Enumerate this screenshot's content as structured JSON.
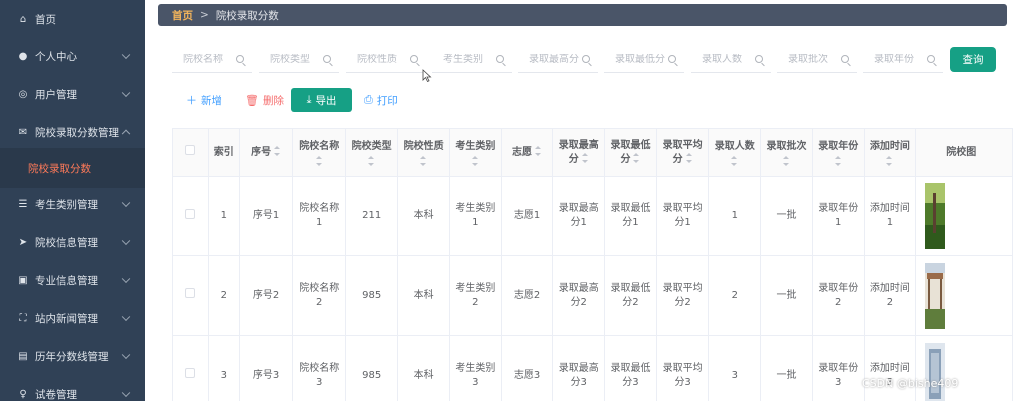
{
  "sidebar": {
    "items": [
      {
        "label": "首页",
        "icon": "home-icon",
        "glyph": "⌂",
        "has_arrow": false
      },
      {
        "label": "个人中心",
        "icon": "user-icon",
        "glyph": "●",
        "has_arrow": true
      },
      {
        "label": "用户管理",
        "icon": "user-manage-icon",
        "glyph": "◎",
        "has_arrow": true
      },
      {
        "label": "院校录取分数管理",
        "icon": "mail-icon",
        "glyph": "✉",
        "has_arrow": true,
        "expanded": true
      },
      {
        "label": "考生类别管理",
        "icon": "sliders-icon",
        "glyph": "☰",
        "has_arrow": true
      },
      {
        "label": "院校信息管理",
        "icon": "send-icon",
        "glyph": "➤",
        "has_arrow": true
      },
      {
        "label": "专业信息管理",
        "icon": "clipboard-icon",
        "glyph": "▣",
        "has_arrow": true
      },
      {
        "label": "站内新闻管理",
        "icon": "frame-icon",
        "glyph": "⛶",
        "has_arrow": true
      },
      {
        "label": "历年分数线管理",
        "icon": "film-icon",
        "glyph": "▤",
        "has_arrow": true
      },
      {
        "label": "试卷管理",
        "icon": "mic-icon",
        "glyph": "♀",
        "has_arrow": true
      }
    ],
    "active_sub": "院校录取分数"
  },
  "breadcrumb": {
    "home": "首页",
    "separator": ">",
    "current": "院校录取分数"
  },
  "search": {
    "fields": [
      {
        "name": "school-name",
        "placeholder": "院校名称"
      },
      {
        "name": "school-type",
        "placeholder": "院校类型"
      },
      {
        "name": "school-nature",
        "placeholder": "院校性质"
      },
      {
        "name": "candidate-category",
        "placeholder": "考生类别"
      },
      {
        "name": "max-score",
        "placeholder": "录取最高分"
      },
      {
        "name": "min-score",
        "placeholder": "录取最低分"
      },
      {
        "name": "admit-count",
        "placeholder": "录取人数"
      },
      {
        "name": "admit-batch",
        "placeholder": "录取批次"
      },
      {
        "name": "admit-year",
        "placeholder": "录取年份"
      }
    ],
    "query_label": "查询"
  },
  "actions": {
    "add": "新增",
    "delete": "删除",
    "export": "导出",
    "print": "打印"
  },
  "table": {
    "headers": [
      {
        "key": "index",
        "label": "索引",
        "sortable": false
      },
      {
        "key": "seq",
        "label": "序号",
        "sortable": true,
        "inline": true
      },
      {
        "key": "school_name",
        "label": "院校名称",
        "sortable": true
      },
      {
        "key": "school_type",
        "label": "院校类型",
        "sortable": true
      },
      {
        "key": "school_nature",
        "label": "院校性质",
        "sortable": true
      },
      {
        "key": "category",
        "label": "考生类别",
        "sortable": true
      },
      {
        "key": "wish",
        "label": "志愿",
        "sortable": true,
        "inline": true
      },
      {
        "key": "max_score",
        "label": "录取最高分",
        "sortable": true
      },
      {
        "key": "min_score",
        "label": "录取最低分",
        "sortable": true
      },
      {
        "key": "avg_score",
        "label": "录取平均分",
        "sortable": true
      },
      {
        "key": "count",
        "label": "录取人数",
        "sortable": true
      },
      {
        "key": "batch",
        "label": "录取批次",
        "sortable": true
      },
      {
        "key": "year",
        "label": "录取年份",
        "sortable": true
      },
      {
        "key": "added",
        "label": "添加时间",
        "sortable": true
      },
      {
        "key": "image",
        "label": "院校图",
        "sortable": false
      }
    ],
    "rows": [
      {
        "index": "1",
        "seq": "序号1",
        "school_name": "院校名称1",
        "school_type": "211",
        "school_nature": "本科",
        "category": "考生类别1",
        "wish": "志愿1",
        "max_score": "录取最高分1",
        "min_score": "录取最低分1",
        "avg_score": "录取平均分1",
        "count": "1",
        "batch": "一批",
        "year": "录取年份1",
        "added": "添加时间1"
      },
      {
        "index": "2",
        "seq": "序号2",
        "school_name": "院校名称2",
        "school_type": "985",
        "school_nature": "本科",
        "category": "考生类别2",
        "wish": "志愿2",
        "max_score": "录取最高分2",
        "min_score": "录取最低分2",
        "avg_score": "录取平均分2",
        "count": "2",
        "batch": "一批",
        "year": "录取年份2",
        "added": "添加时间2"
      },
      {
        "index": "3",
        "seq": "序号3",
        "school_name": "院校名称3",
        "school_type": "985",
        "school_nature": "本科",
        "category": "考生类别3",
        "wish": "志愿3",
        "max_score": "录取最高分3",
        "min_score": "录取最低分3",
        "avg_score": "录取平均分3",
        "count": "3",
        "batch": "一批",
        "year": "录取年份3",
        "added": "添加时间3"
      }
    ]
  },
  "watermark": "CSDN @bishe409",
  "colors": {
    "sidebar_bg": "#304156",
    "accent_green": "#16a085",
    "active_text": "#ff7a59",
    "link_blue": "#409eff",
    "danger_red": "#f56c6c"
  }
}
